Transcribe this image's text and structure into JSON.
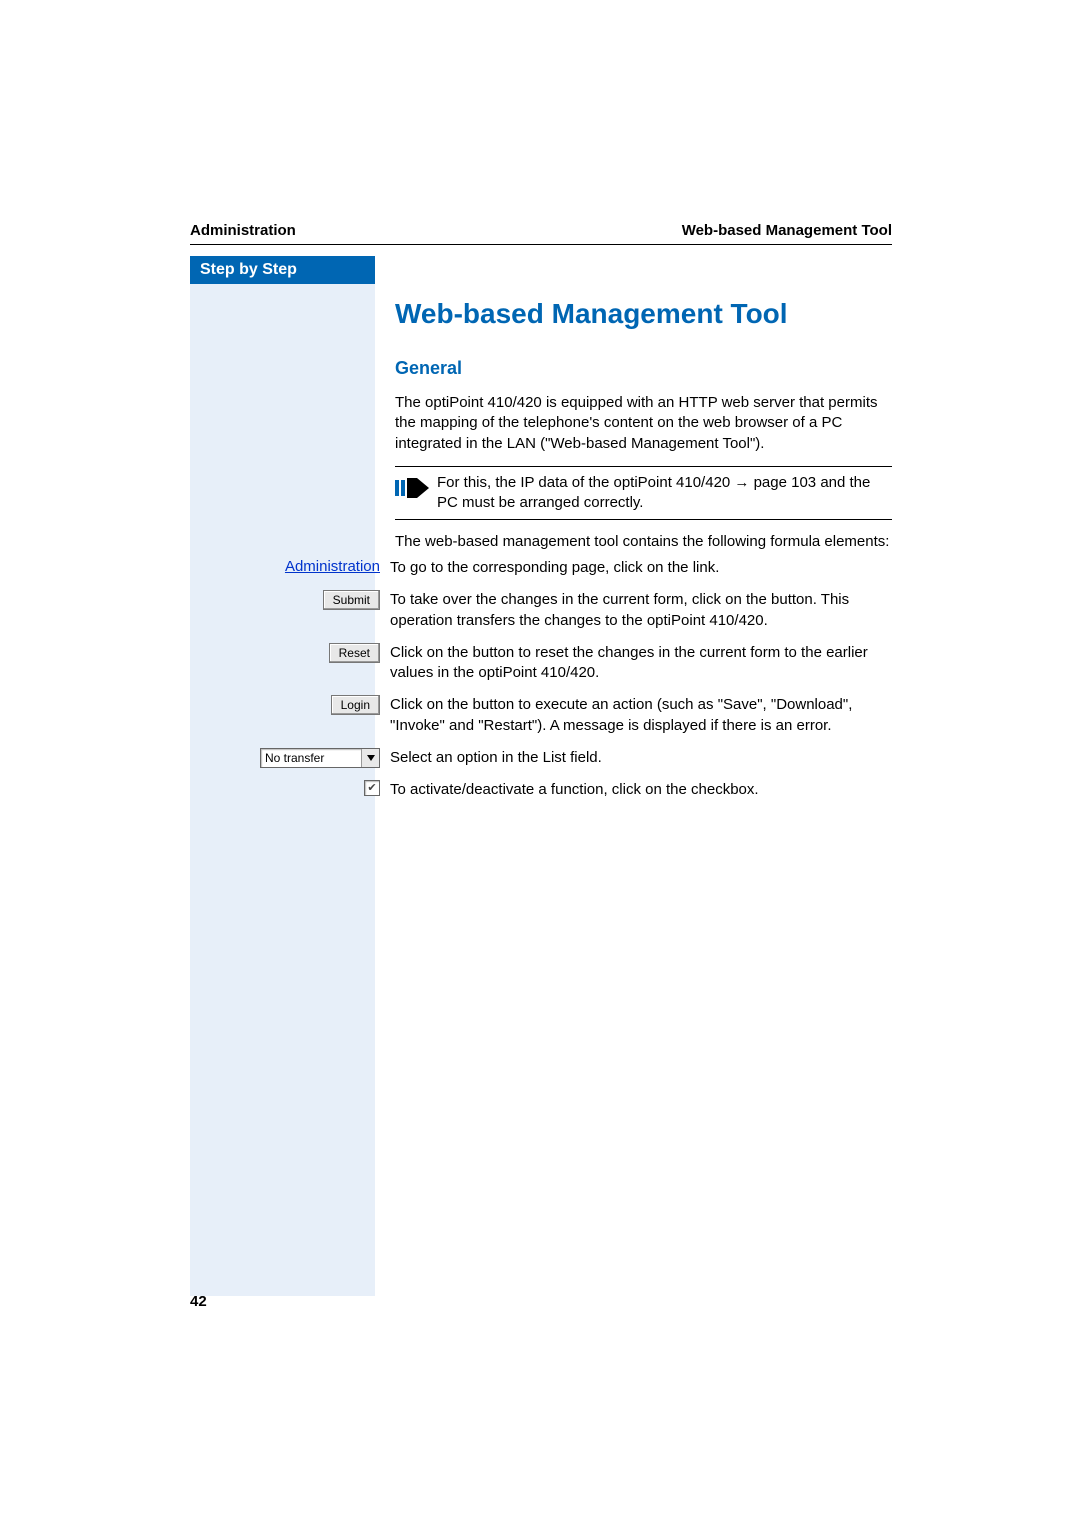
{
  "header": {
    "left": "Administration",
    "right": "Web-based Management Tool"
  },
  "sidebar": {
    "tab_label": "Step by Step"
  },
  "content": {
    "h1": "Web-based Management Tool",
    "h2": "General",
    "para1": "The optiPoint 410/420 is equipped with an HTTP web server that permits the mapping of the telephone's content on the web browser of a PC integrated in the LAN (\"Web-based Management Tool\").",
    "note_pre": "For this, the IP data of the optiPoint 410/420 ",
    "note_arrow": "→",
    "note_post": " page 103 and the PC must be arranged correctly.",
    "para2": "The web-based management tool contains the following formula elements:"
  },
  "elements": [
    {
      "control_type": "link",
      "control_label": "Administration",
      "desc": "To go to the corresponding page, click on the link."
    },
    {
      "control_type": "button",
      "control_label": "Submit",
      "desc": "To take over the changes in the current form, click on the button. This operation transfers the changes to the optiPoint 410/420."
    },
    {
      "control_type": "button",
      "control_label": "Reset",
      "desc": "Click on the button to reset the changes in the current form to the earlier values in the optiPoint 410/420."
    },
    {
      "control_type": "button",
      "control_label": "Login",
      "desc": "Click on the button to execute an action (such as \"Save\", \"Download\", \"Invoke\" and \"Restart\"). A message is displayed if there is an error."
    },
    {
      "control_type": "select",
      "control_label": "No transfer",
      "desc": "Select an option in the List field."
    },
    {
      "control_type": "checkbox",
      "control_label": "checked",
      "desc": "To activate/deactivate a function, click on the checkbox."
    }
  ],
  "page_number": "42"
}
